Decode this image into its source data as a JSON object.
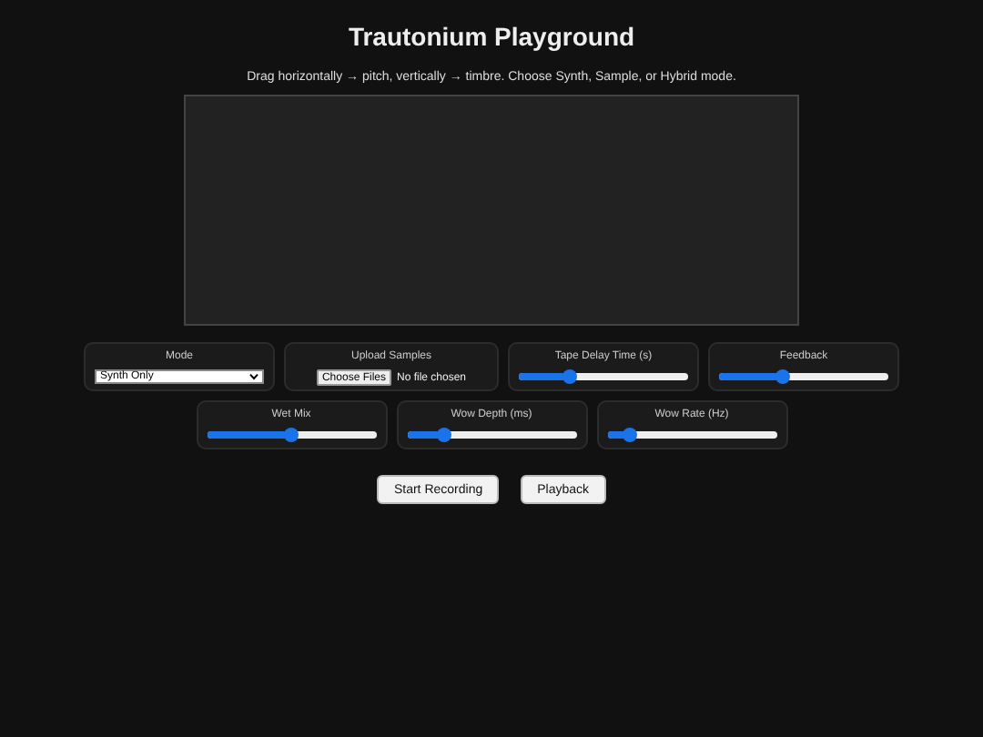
{
  "title": "Trautonium Playground",
  "instructions": "Drag horizontally → pitch, vertically → timbre. Choose Synth, Sample, or Hybrid mode.",
  "controls": [
    {
      "kind": "select",
      "label": "Mode",
      "value": "Synth Only"
    },
    {
      "kind": "file",
      "label": "Upload Samples",
      "button": "Choose Files",
      "status": "No file chosen"
    },
    {
      "kind": "slider",
      "label": "Tape Delay Time (s)",
      "level": 0.3
    },
    {
      "kind": "slider",
      "label": "Feedback",
      "level": 0.38
    },
    {
      "kind": "slider",
      "label": "Wet Mix",
      "level": 0.5
    },
    {
      "kind": "slider",
      "label": "Wow Depth (ms)",
      "level": 0.22
    },
    {
      "kind": "slider",
      "label": "Wow Rate (Hz)",
      "level": 0.13
    }
  ],
  "buttons": [
    "Start Recording",
    "Playback"
  ]
}
